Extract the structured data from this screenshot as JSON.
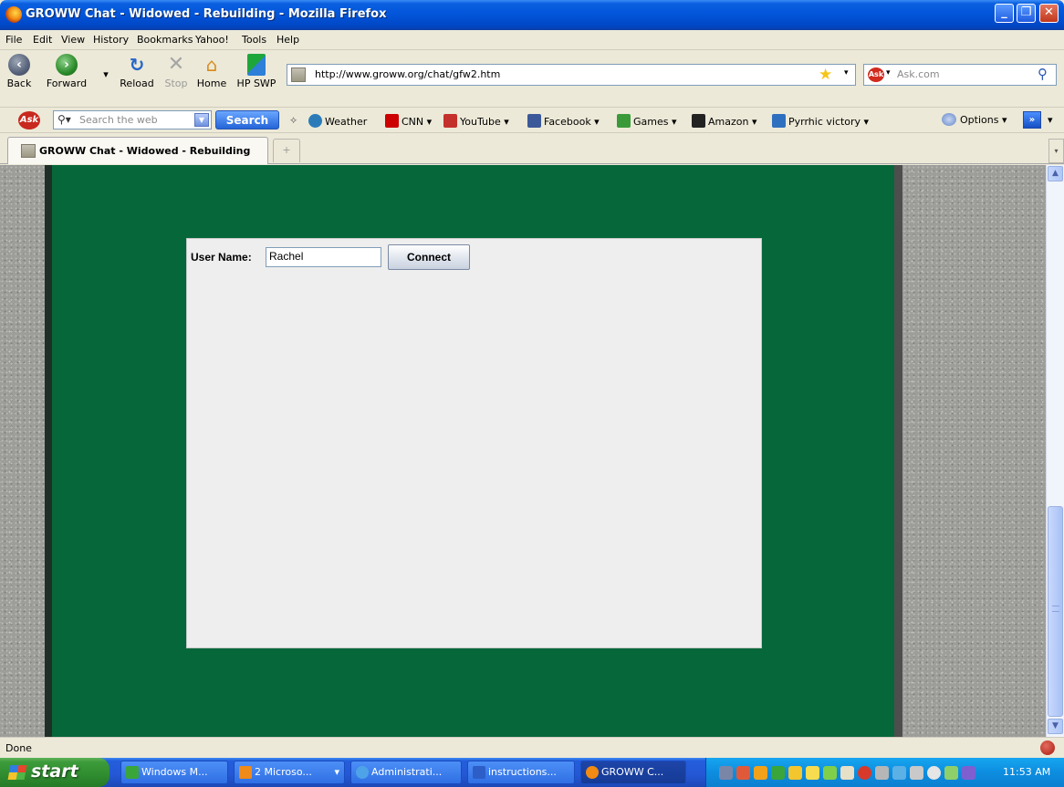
{
  "window": {
    "title": "GROWW Chat - Widowed - Rebuilding - Mozilla Firefox"
  },
  "menu": [
    "File",
    "Edit",
    "View",
    "History",
    "Bookmarks",
    "Yahoo!",
    "Tools",
    "Help"
  ],
  "nav": {
    "back": "Back",
    "forward": "Forward",
    "reload": "Reload",
    "stop": "Stop",
    "home": "Home",
    "hpswp": "HP SWP",
    "url": "http://www.groww.org/chat/gfw2.htm",
    "search_placeholder": "Ask.com"
  },
  "ask_toolbar": {
    "search_placeholder": "Search the web",
    "search_button": "Search",
    "items": [
      {
        "label": "Weather",
        "icon": "weather-icon",
        "color": "#2b7bb9"
      },
      {
        "label": "CNN ▾",
        "icon": "cnn-icon",
        "color": "#cc0000"
      },
      {
        "label": "YouTube ▾",
        "icon": "youtube-icon",
        "color": "#c4302b"
      },
      {
        "label": "Facebook ▾",
        "icon": "facebook-icon",
        "color": "#3b5998"
      },
      {
        "label": "Games ▾",
        "icon": "games-icon",
        "color": "#3a9a3a"
      },
      {
        "label": "Amazon ▾",
        "icon": "amazon-icon",
        "color": "#222222"
      },
      {
        "label": "Pyrrhic victory ▾",
        "icon": "pyrrhic-icon",
        "color": "#2f6fbf"
      }
    ],
    "options": "Options",
    "chevron": "»"
  },
  "tab": {
    "label": "GROWW Chat - Widowed - Rebuilding"
  },
  "applet": {
    "username_label": "User Name:",
    "username_value": "Rachel",
    "connect_label": "Connect"
  },
  "status": {
    "text": "Done"
  },
  "taskbar": {
    "start": "start",
    "tasks": [
      {
        "label": "Windows M...",
        "icon": "messenger-icon",
        "color": "#3aa53a"
      },
      {
        "label": "2 Microso...",
        "icon": "office-icon",
        "color": "#f08a18"
      },
      {
        "label": "Administrati...",
        "icon": "ie-icon",
        "color": "#4ea3e8"
      },
      {
        "label": "instructions...",
        "icon": "word-icon",
        "color": "#2d5ec8"
      },
      {
        "label": "GROWW C...",
        "icon": "firefox-icon",
        "color": "#f28a13"
      }
    ],
    "clock": "11:53 AM"
  },
  "colors": {
    "page_green": "#05673a",
    "applet_bg": "#eeeeee"
  }
}
